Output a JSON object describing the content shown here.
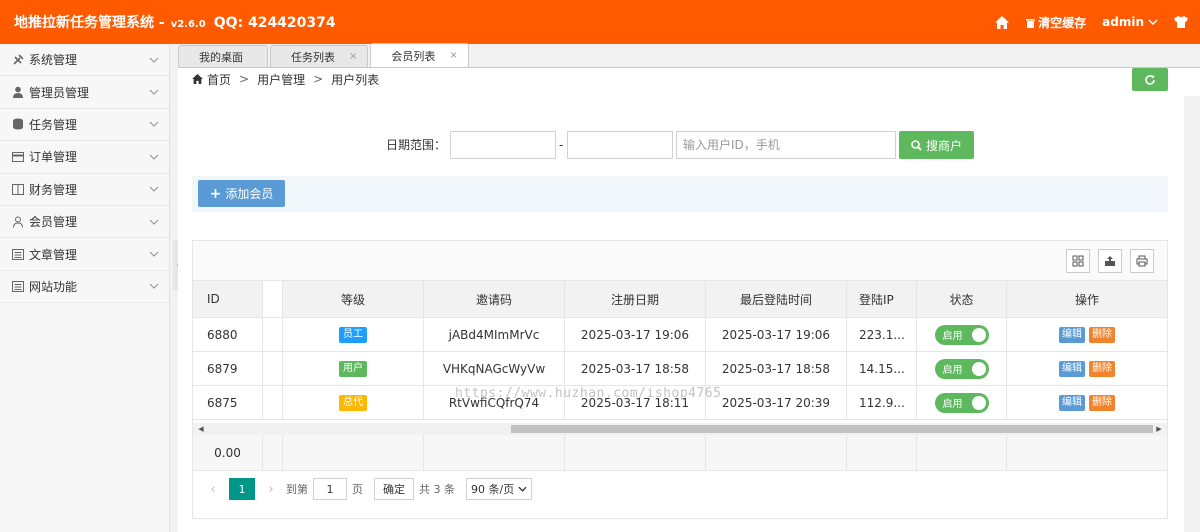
{
  "header": {
    "title": "地推拉新任务管理系统 -",
    "version": "v2.6.0",
    "qq": "QQ: 424420374",
    "clear_cache": "清空缓存",
    "user": "admin",
    "brand_color": "#ff5a00"
  },
  "sidebar": {
    "items": [
      {
        "label": "系统管理",
        "icon": "wrench-icon"
      },
      {
        "label": "管理员管理",
        "icon": "user-icon"
      },
      {
        "label": "任务管理",
        "icon": "database-icon"
      },
      {
        "label": "订单管理",
        "icon": "card-icon"
      },
      {
        "label": "财务管理",
        "icon": "book-icon"
      },
      {
        "label": "会员管理",
        "icon": "users-icon"
      },
      {
        "label": "文章管理",
        "icon": "list-icon"
      },
      {
        "label": "网站功能",
        "icon": "list-icon"
      }
    ]
  },
  "tabs": [
    {
      "label": "我的桌面",
      "active": false
    },
    {
      "label": "任务列表",
      "active": false
    },
    {
      "label": "会员列表",
      "active": true
    }
  ],
  "tab_close": "×",
  "breadcrumb": {
    "home": "首页",
    "sep": ">",
    "level1": "用户管理",
    "level2": "用户列表"
  },
  "search": {
    "date_label": "日期范围：",
    "dash": "-",
    "keyword_placeholder": "输入用户ID，手机",
    "button": "搜商户"
  },
  "toolbar": {
    "add_button": "添加会员",
    "plus": "+"
  },
  "table": {
    "columns": [
      "ID",
      "等级",
      "邀请码",
      "注册日期",
      "最后登陆时间",
      "登陆IP",
      "状态",
      "操作"
    ],
    "rows": [
      {
        "id": "6880",
        "level": "员工",
        "level_color": "#1e9fff",
        "code": "jABd4MImMrVc",
        "reg": "2025-03-17 19:06",
        "last": "2025-03-17 19:06",
        "ip": "223.1...",
        "status": "启用",
        "edit": "编辑",
        "del": "删除"
      },
      {
        "id": "6879",
        "level": "用户",
        "level_color": "#5eb95e",
        "code": "VHKqNAGcWyVw",
        "reg": "2025-03-17 18:58",
        "last": "2025-03-17 18:58",
        "ip": "14.15...",
        "status": "启用",
        "edit": "编辑",
        "del": "删除"
      },
      {
        "id": "6875",
        "level": "总代",
        "level_color": "#ffb800",
        "code": "RtVwfiCQfrQ74",
        "reg": "2025-03-17 18:11",
        "last": "2025-03-17 20:39",
        "ip": "112.9...",
        "status": "启用",
        "edit": "编辑",
        "del": "删除"
      }
    ],
    "total": "0.00"
  },
  "pager": {
    "current": "1",
    "goto_label": "到第",
    "goto_value": "1",
    "page_unit": "页",
    "confirm": "确定",
    "total": "共 3 条",
    "per_page": "90 条/页"
  },
  "watermark": "https://www.huzhan.com/ishop4765"
}
